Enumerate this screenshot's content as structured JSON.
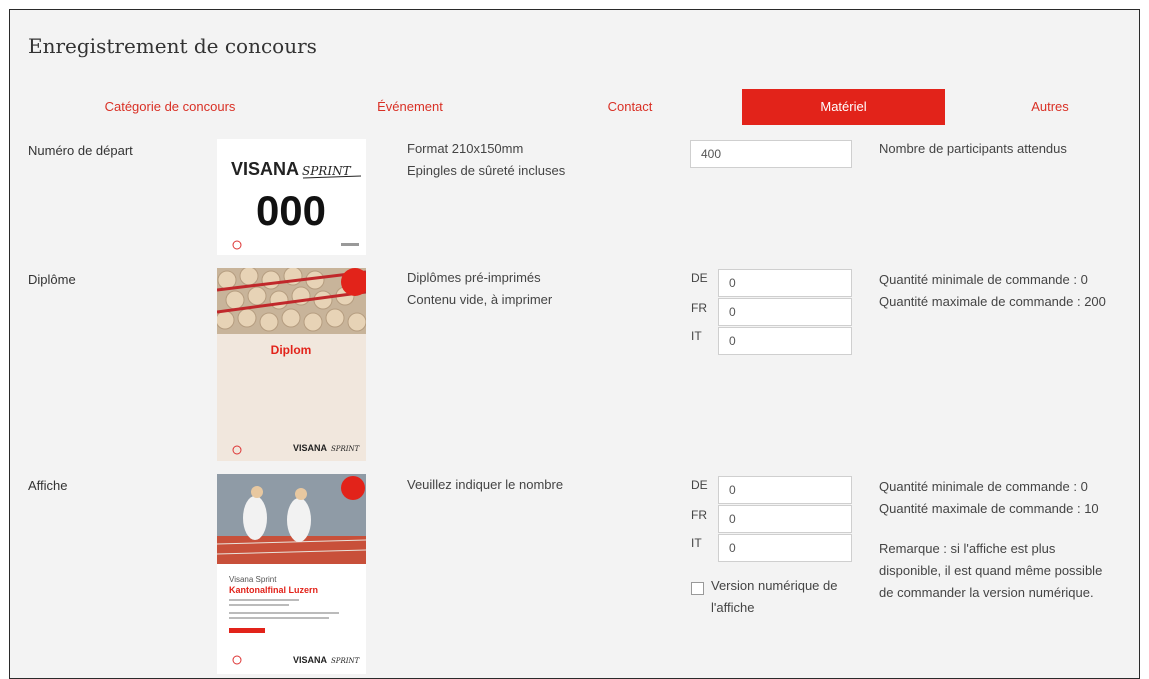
{
  "page": {
    "title": "Enregistrement de concours"
  },
  "tabs": [
    {
      "label": "Catégorie de concours",
      "active": false
    },
    {
      "label": "Événement",
      "active": false
    },
    {
      "label": "Contact",
      "active": false
    },
    {
      "label": "Matériel",
      "active": true
    },
    {
      "label": "Autres",
      "active": false
    }
  ],
  "colors": {
    "accent": "#e2231a",
    "tab_text": "#d93025",
    "panel_bg": "#f3f3f3"
  },
  "items": {
    "start_number": {
      "label": "Numéro de départ",
      "desc_lines": [
        "Format 210x150mm",
        "Epingles de sûreté incluses"
      ],
      "input_value": "400",
      "note": "Nombre de participants attendus",
      "image": {
        "brand": "VISANA",
        "brand_sub": "SPRINT",
        "number": "000"
      }
    },
    "diploma": {
      "label": "Diplôme",
      "desc_lines": [
        "Diplômes pré-imprimés",
        "Contenu vide, à imprimer"
      ],
      "langs": [
        {
          "code": "DE",
          "value": "0"
        },
        {
          "code": "FR",
          "value": "0"
        },
        {
          "code": "IT",
          "value": "0"
        }
      ],
      "notes": [
        "Quantité minimale de commande : 0",
        "Quantité maximale de commande : 200"
      ],
      "image": {
        "title": "Diplom",
        "brand": "VISANA",
        "brand_sub": "SPRINT"
      }
    },
    "poster": {
      "label": "Affiche",
      "desc": "Veuillez indiquer le nombre",
      "langs": [
        {
          "code": "DE",
          "value": "0"
        },
        {
          "code": "FR",
          "value": "0"
        },
        {
          "code": "IT",
          "value": "0"
        }
      ],
      "checkbox_label_lines": [
        "Version numérique de",
        "l'affiche"
      ],
      "checkbox_checked": false,
      "notes": [
        "Quantité minimale de commande : 0",
        "Quantité maximale de commande : 10"
      ],
      "remark_lines": [
        "Remarque : si l'affiche est plus",
        "disponible, il est quand même possible",
        "de commander la version numérique."
      ],
      "image": {
        "small": "Visana Sprint",
        "title": "Kantonalfinal Luzern",
        "brand": "VISANA",
        "brand_sub": "SPRINT"
      }
    }
  }
}
